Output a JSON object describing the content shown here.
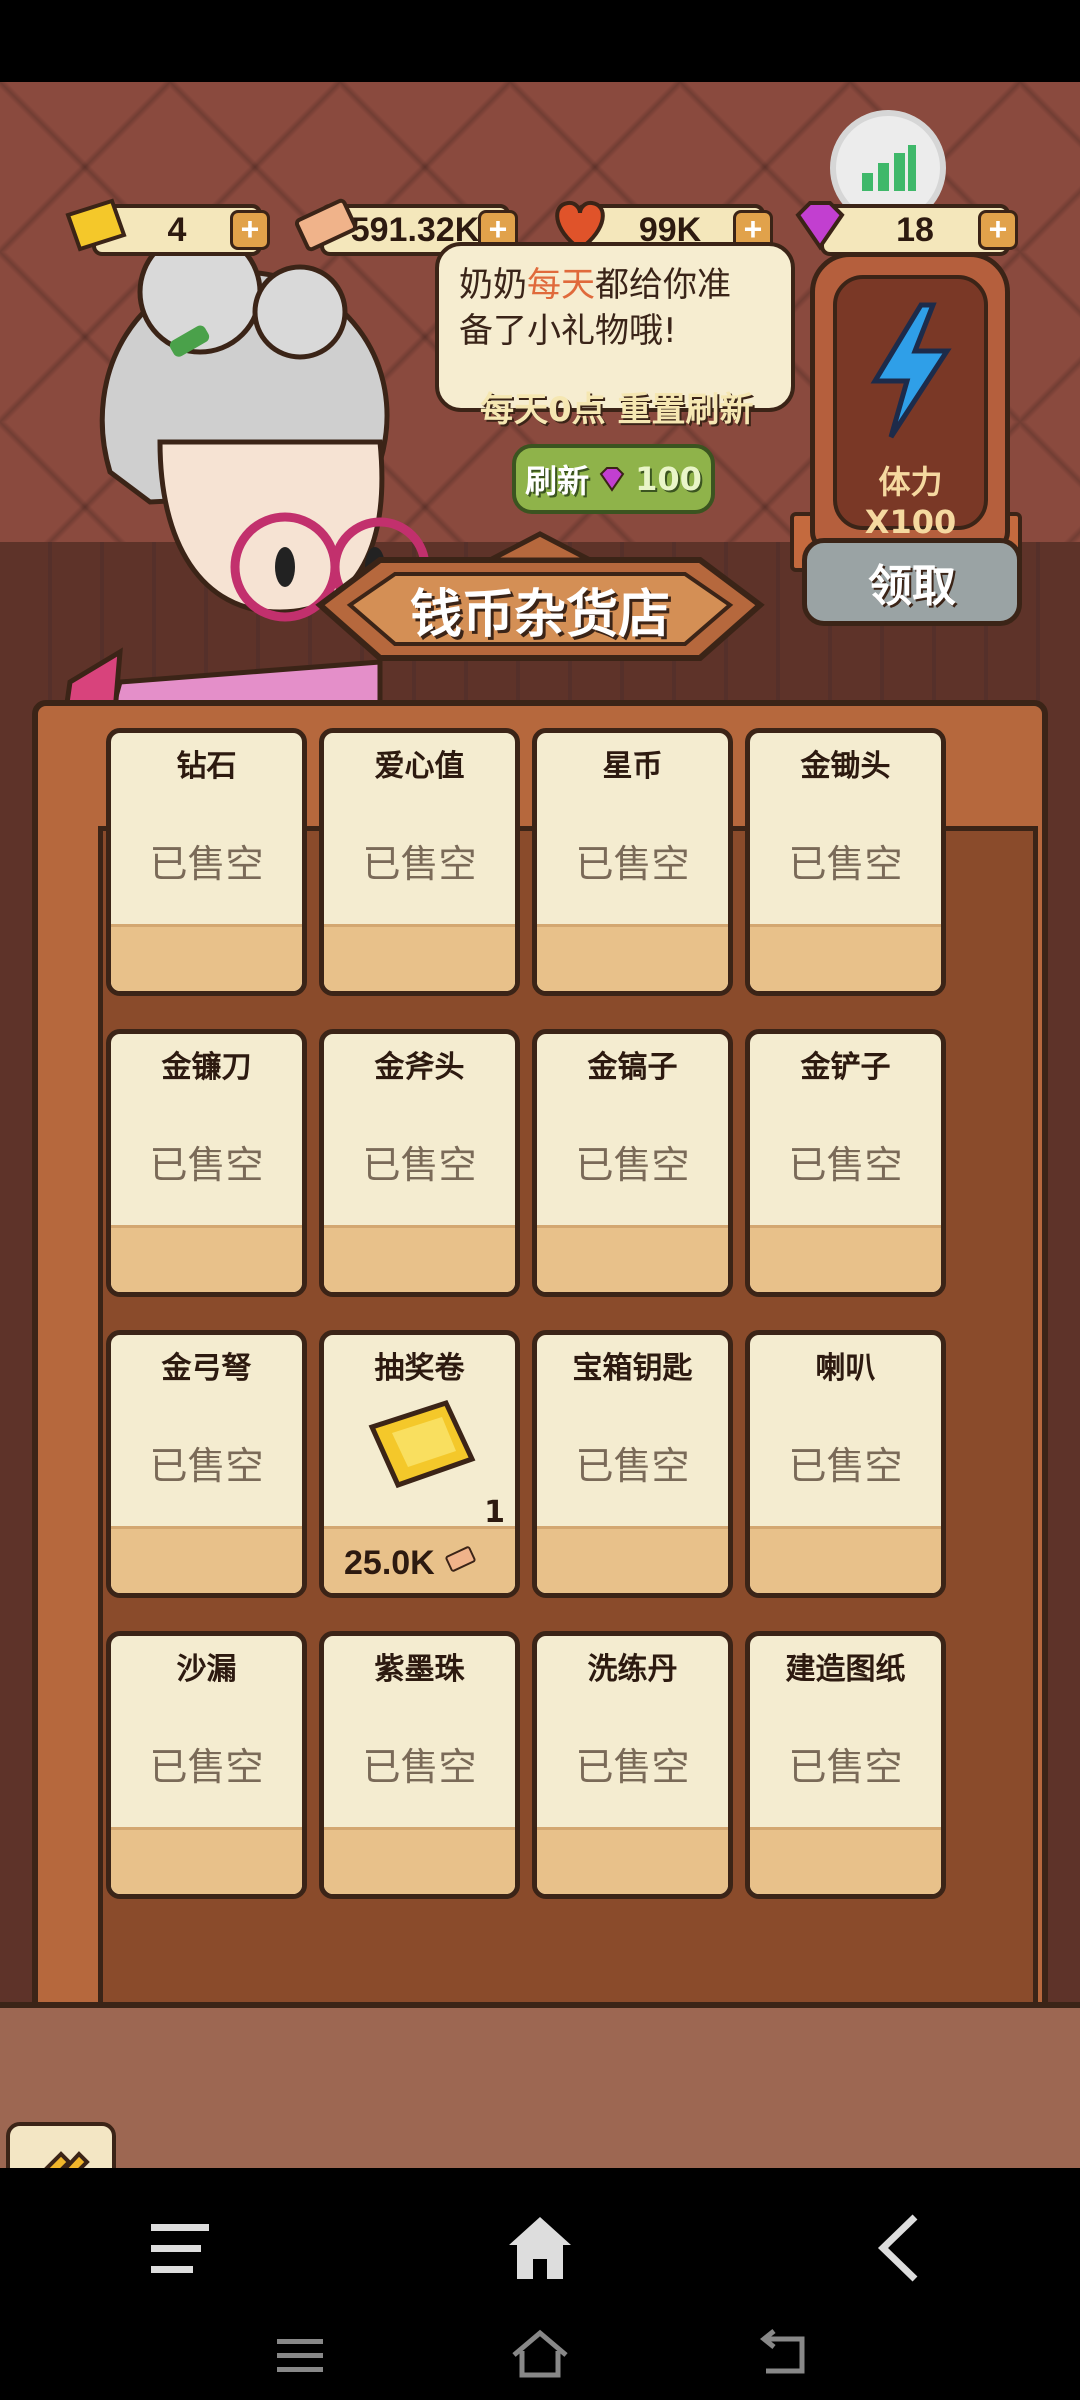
{
  "resources": {
    "tickets": "4",
    "coins": "591.32K",
    "hearts": "99K",
    "gems": "18"
  },
  "speech": {
    "line1_pre": "奶奶",
    "line1_hi": "每天",
    "line1_post": "都给你准",
    "line2": "备了小礼物哦!"
  },
  "reset_note": "每天0点 重置刷新",
  "refresh": {
    "label": "刷新",
    "cost": "100"
  },
  "stamina": {
    "label": "体力X100",
    "claim": "领取"
  },
  "shop_title": "钱币杂货店",
  "items": [
    {
      "name": "钻石",
      "status": "已售空"
    },
    {
      "name": "爱心值",
      "status": "已售空"
    },
    {
      "name": "星币",
      "status": "已售空"
    },
    {
      "name": "金锄头",
      "status": "已售空"
    },
    {
      "name": "金镰刀",
      "status": "已售空"
    },
    {
      "name": "金斧头",
      "status": "已售空"
    },
    {
      "name": "金镐子",
      "status": "已售空"
    },
    {
      "name": "金铲子",
      "status": "已售空"
    },
    {
      "name": "金弓弩",
      "status": "已售空"
    },
    {
      "name": "抽奖卷",
      "quantity": "1",
      "price": "25.0K"
    },
    {
      "name": "宝箱钥匙",
      "status": "已售空"
    },
    {
      "name": "喇叭",
      "status": "已售空"
    },
    {
      "name": "沙漏",
      "status": "已售空"
    },
    {
      "name": "紫墨珠",
      "status": "已售空"
    },
    {
      "name": "洗练丹",
      "status": "已售空"
    },
    {
      "name": "建造图纸",
      "status": "已售空"
    }
  ],
  "colors": {
    "gem": "#c23fd0",
    "ticket": "#f4c82a",
    "heart": "#e0532a",
    "lightning": "#2f9fe8"
  }
}
